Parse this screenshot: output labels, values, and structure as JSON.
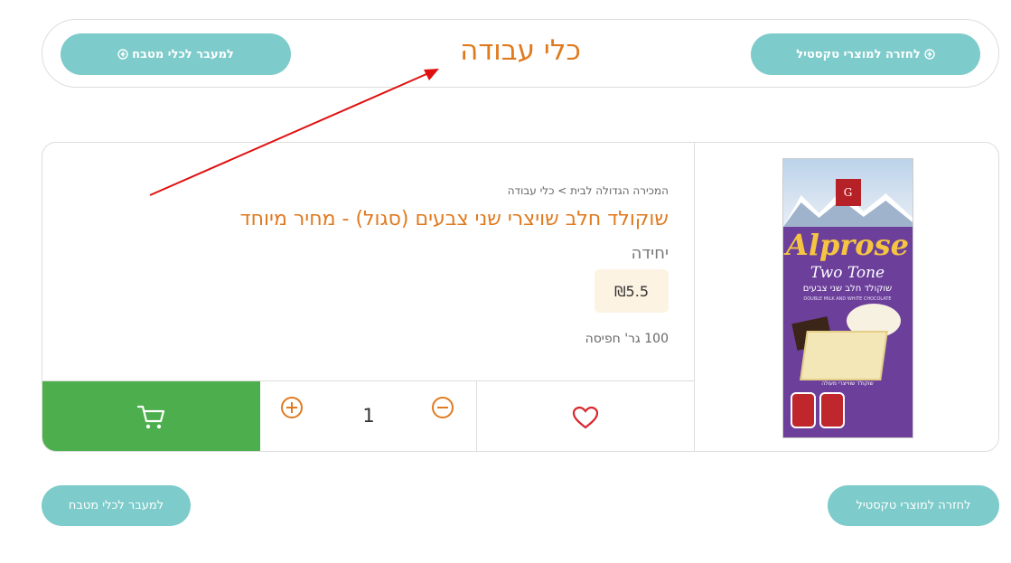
{
  "header": {
    "title": "כלי עבודה",
    "back_textile_label": "לחזרה למוצרי טקסטיל",
    "to_kitchen_label": "למעבר לכלי מטבח"
  },
  "product": {
    "breadcrumb": "המכירה הגדולה לבית > כלי עבודה",
    "name": "שוקולד חלב שויצרי שני צבעים (סגול) - מחיר מיוחד",
    "unit": "יחידה",
    "price": "₪5.5",
    "weight": "100 גר' חפיסה",
    "quantity": "1",
    "image": {
      "brand": "Alprose",
      "subtitle": "Two Tone",
      "text_he": "שוקולד חלב שני צבעים",
      "text_en": "DOUBLE MILK AND WHITE CHOCOLATE",
      "logo_letter": "G",
      "bottom_text": "שוקולד שווייצרי מעולה"
    }
  },
  "footer": {
    "back_textile_label": "לחזרה למוצרי טקסטיל",
    "to_kitchen_label": "למעבר לכלי מטבח"
  },
  "icons": {
    "cart": "cart-icon",
    "heart": "heart-icon",
    "plus": "plus-circle-icon",
    "minus": "minus-circle-icon",
    "arrow_circle": "arrow-circle-icon"
  },
  "colors": {
    "accent_teal": "#7ecbcb",
    "title_orange": "#e07a1f",
    "cart_green": "#4cae4c",
    "price_bg": "#fdf3e3",
    "annotation_red": "#e01010"
  }
}
